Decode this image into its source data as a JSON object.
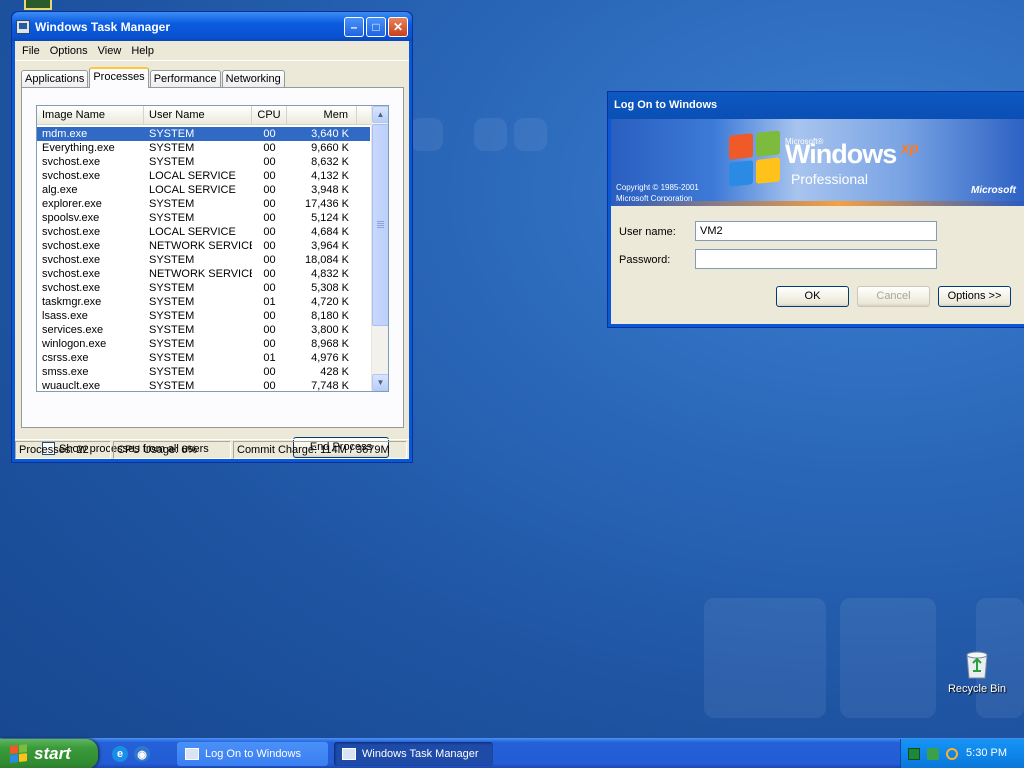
{
  "task_manager": {
    "title": "Windows Task Manager",
    "menu": [
      "File",
      "Options",
      "View",
      "Help"
    ],
    "tabs": [
      "Applications",
      "Processes",
      "Performance",
      "Networking"
    ],
    "active_tab": "Processes",
    "columns": [
      "Image Name",
      "User Name",
      "CPU",
      "Mem Usage"
    ],
    "processes": [
      {
        "name": "mdm.exe",
        "user": "SYSTEM",
        "cpu": "00",
        "mem": "3,640 K",
        "selected": true
      },
      {
        "name": "Everything.exe",
        "user": "SYSTEM",
        "cpu": "00",
        "mem": "9,660 K"
      },
      {
        "name": "svchost.exe",
        "user": "SYSTEM",
        "cpu": "00",
        "mem": "8,632 K"
      },
      {
        "name": "svchost.exe",
        "user": "LOCAL SERVICE",
        "cpu": "00",
        "mem": "4,132 K"
      },
      {
        "name": "alg.exe",
        "user": "LOCAL SERVICE",
        "cpu": "00",
        "mem": "3,948 K"
      },
      {
        "name": "explorer.exe",
        "user": "SYSTEM",
        "cpu": "00",
        "mem": "17,436 K"
      },
      {
        "name": "spoolsv.exe",
        "user": "SYSTEM",
        "cpu": "00",
        "mem": "5,124 K"
      },
      {
        "name": "svchost.exe",
        "user": "LOCAL SERVICE",
        "cpu": "00",
        "mem": "4,684 K"
      },
      {
        "name": "svchost.exe",
        "user": "NETWORK SERVICE",
        "cpu": "00",
        "mem": "3,964 K"
      },
      {
        "name": "svchost.exe",
        "user": "SYSTEM",
        "cpu": "00",
        "mem": "18,084 K"
      },
      {
        "name": "svchost.exe",
        "user": "NETWORK SERVICE",
        "cpu": "00",
        "mem": "4,832 K"
      },
      {
        "name": "svchost.exe",
        "user": "SYSTEM",
        "cpu": "00",
        "mem": "5,308 K"
      },
      {
        "name": "taskmgr.exe",
        "user": "SYSTEM",
        "cpu": "01",
        "mem": "4,720 K"
      },
      {
        "name": "lsass.exe",
        "user": "SYSTEM",
        "cpu": "00",
        "mem": "8,180 K"
      },
      {
        "name": "services.exe",
        "user": "SYSTEM",
        "cpu": "00",
        "mem": "3,800 K"
      },
      {
        "name": "winlogon.exe",
        "user": "SYSTEM",
        "cpu": "00",
        "mem": "8,968 K"
      },
      {
        "name": "csrss.exe",
        "user": "SYSTEM",
        "cpu": "01",
        "mem": "4,976 K"
      },
      {
        "name": "smss.exe",
        "user": "SYSTEM",
        "cpu": "00",
        "mem": "428 K"
      },
      {
        "name": "wuauclt.exe",
        "user": "SYSTEM",
        "cpu": "00",
        "mem": "7,748 K"
      }
    ],
    "show_all_label": "Show processes from all users",
    "end_process_label": "End Process",
    "status": {
      "processes": "Processes: 22",
      "cpu": "CPU Usage: 6%",
      "commit": "Commit Charge: 114M / 3679M"
    }
  },
  "logon": {
    "title": "Log On to Windows",
    "banner": {
      "microsoft_small": "Microsoft®",
      "windows": "Windows",
      "xp": "xp",
      "edition": "Professional",
      "copyright_line1": "Copyright © 1985-2001",
      "copyright_line2": "Microsoft Corporation",
      "brand": "Microsoft"
    },
    "username_label": "User name:",
    "username_value": "VM2",
    "password_label": "Password:",
    "password_value": "",
    "ok_label": "OK",
    "cancel_label": "Cancel",
    "options_label": "Options >>"
  },
  "desktop": {
    "recycle_bin_label": "Recycle Bin"
  },
  "taskbar": {
    "start_label": "start",
    "tasks": [
      {
        "label": "Log On to Windows",
        "active": false
      },
      {
        "label": "Windows Task Manager",
        "active": true
      }
    ],
    "clock": "5:30 PM"
  },
  "colors": {
    "selection": "#316ac5",
    "titlebar": "#0a58d6",
    "start_green": "#3a9a3a"
  }
}
